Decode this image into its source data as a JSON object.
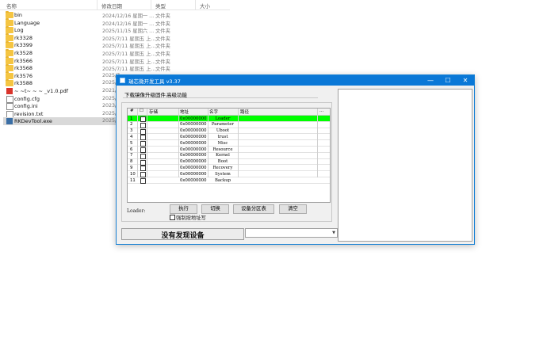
{
  "explorer": {
    "columns": {
      "name": "名称",
      "date": "修改日期",
      "type": "类型",
      "size": "大小"
    },
    "files": [
      {
        "name": "bin",
        "date": "2024/12/16 星期一 ...",
        "type": "文件夹",
        "icon": "folder-icon"
      },
      {
        "name": "Language",
        "date": "2024/12/16 星期一 ...",
        "type": "文件夹",
        "icon": "folder-icon"
      },
      {
        "name": "Log",
        "date": "2025/11/15 星期六 ...",
        "type": "文件夹",
        "icon": "folder-icon"
      },
      {
        "name": "rk3328",
        "date": "2025/7/11 星期五 上...",
        "type": "文件夹",
        "icon": "folder-icon"
      },
      {
        "name": "rk3399",
        "date": "2025/7/11 星期五 上...",
        "type": "文件夹",
        "icon": "folder-icon"
      },
      {
        "name": "rk3528",
        "date": "2025/7/11 星期五 上...",
        "type": "文件夹",
        "icon": "folder-icon"
      },
      {
        "name": "rk3566",
        "date": "2025/7/11 星期五 上...",
        "type": "文件夹",
        "icon": "folder-icon"
      },
      {
        "name": "rk3568",
        "date": "2025/7/11 星期五 上...",
        "type": "文件夹",
        "icon": "folder-icon"
      },
      {
        "name": "rk3576",
        "date": "2025/7",
        "type": "",
        "icon": "folder-icon"
      },
      {
        "name": "rk3588",
        "date": "2025/7",
        "type": "",
        "icon": "folder-icon"
      },
      {
        "name": "~ ~t~ ~ ~ _v1.0.pdf",
        "date": "2021/8",
        "type": "",
        "icon": "pdf-icon"
      },
      {
        "name": "config.cfg",
        "date": "2025/7",
        "type": "",
        "icon": "cfg-icon"
      },
      {
        "name": "config.ini",
        "date": "2023/1",
        "type": "",
        "icon": "cfg-icon"
      },
      {
        "name": "revision.txt",
        "date": "2025/2",
        "type": "",
        "icon": "txt-icon"
      },
      {
        "name": "RKDevTool.exe",
        "date": "2025/2",
        "type": "",
        "icon": "exe-icon"
      }
    ]
  },
  "window": {
    "title": "瑞芯微开发工具 v3.37",
    "controls": {
      "minimize": "—",
      "maximize": "☐",
      "close": "✕"
    },
    "menu": [
      "下载镜像",
      "升级固件",
      "高级功能"
    ],
    "grid": {
      "headers": [
        "#",
        "☐",
        "存储",
        "地址",
        "名字",
        "路径",
        "..."
      ],
      "rows": [
        {
          "num": "1",
          "address": "0x00000000",
          "name": "Loader"
        },
        {
          "num": "2",
          "address": "0x00000000",
          "name": "Parameter"
        },
        {
          "num": "3",
          "address": "0x00000000",
          "name": "Uboot"
        },
        {
          "num": "4",
          "address": "0x00000000",
          "name": "trust"
        },
        {
          "num": "5",
          "address": "0x00000000",
          "name": "Misc"
        },
        {
          "num": "6",
          "address": "0x00000000",
          "name": "Resource"
        },
        {
          "num": "7",
          "address": "0x00000000",
          "name": "Kernel"
        },
        {
          "num": "8",
          "address": "0x00000000",
          "name": "Boot"
        },
        {
          "num": "9",
          "address": "0x00000000",
          "name": "Recovery"
        },
        {
          "num": "10",
          "address": "0x00000000",
          "name": "System"
        },
        {
          "num": "11",
          "address": "0x00000000",
          "name": "Backup"
        }
      ]
    },
    "loader_label": "Loader:",
    "buttons": {
      "run": "执行",
      "switch": "切换",
      "partition": "设备分区表",
      "clear": "清空"
    },
    "force_write": "强制按地址写",
    "status": "没有发现设备",
    "combo_arrow": "▼",
    "colors": {
      "titlebar": "#0a78d7",
      "active_row": "#00ff00"
    }
  }
}
